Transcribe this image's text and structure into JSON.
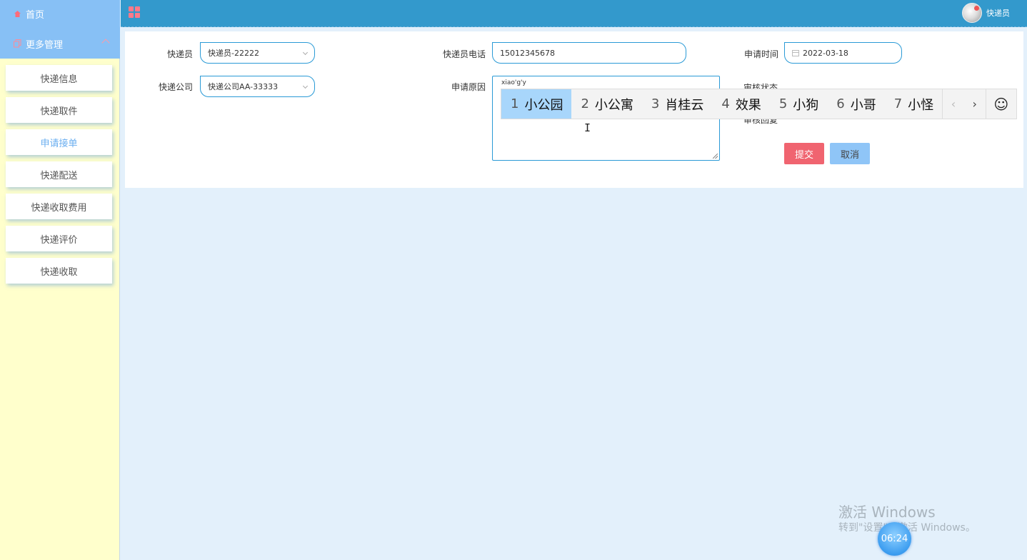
{
  "sidebar": {
    "home_label": "首页",
    "more_label": "更多管理",
    "items": [
      {
        "label": "快递信息"
      },
      {
        "label": "快递取件"
      },
      {
        "label": "申请接单"
      },
      {
        "label": "快递配送"
      },
      {
        "label": "快递收取费用"
      },
      {
        "label": "快递评价"
      },
      {
        "label": "快递收取"
      }
    ],
    "active_index": 2
  },
  "header": {
    "user_name": "快递员"
  },
  "form": {
    "courier_label": "快递员",
    "courier_value": "快递员-22222",
    "phone_label": "快递员电话",
    "phone_value": "15012345678",
    "apply_time_label": "申请时间",
    "apply_time_value": "2022-03-18",
    "company_label": "快递公司",
    "company_value": "快递公司AA-33333",
    "reason_label": "申请原因",
    "reason_value": "xiao'g'y",
    "review_status_label": "审核状态",
    "review_reply_label": "审核回复",
    "submit_label": "提交",
    "cancel_label": "取消"
  },
  "ime": {
    "candidates": [
      {
        "num": "1",
        "text": "小公园"
      },
      {
        "num": "2",
        "text": "小公寓"
      },
      {
        "num": "3",
        "text": "肖桂云"
      },
      {
        "num": "4",
        "text": "效果"
      },
      {
        "num": "5",
        "text": "小狗"
      },
      {
        "num": "6",
        "text": "小哥"
      },
      {
        "num": "7",
        "text": "小怪"
      }
    ],
    "prev_glyph": "‹",
    "next_glyph": "›",
    "emoji_glyph": "☺"
  },
  "watermark": {
    "line1": "激活 Windows",
    "line2": "转到\"设置\"以激活 Windows。"
  },
  "clock": "06:24",
  "colors": {
    "header": "#3399cc",
    "sidebar_top": "#87c0f5",
    "sidebar_bg": "#ffffcc",
    "submit": "#f06470",
    "cancel": "#8fc5f7"
  }
}
